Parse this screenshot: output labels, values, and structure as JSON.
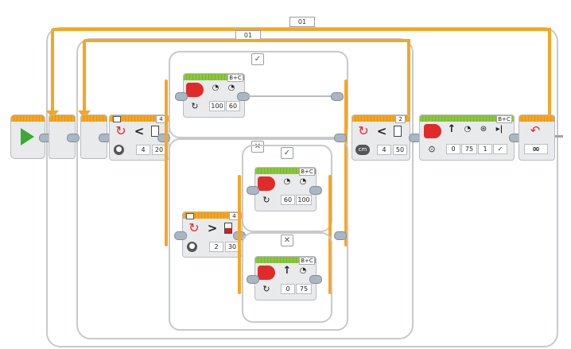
{
  "program": {
    "outer_loop": {
      "name": "01",
      "mode": "infinity"
    },
    "inner_loop": {
      "name": "01",
      "mode": "color sensor compare"
    },
    "start_icon": "play-icon"
  },
  "loop_exit_sensor": {
    "port": "2",
    "operator": "<",
    "value_a": "4",
    "value_b": "50",
    "mode_icon": "cm"
  },
  "switch_main": {
    "sensor_port": "4",
    "operator": "<",
    "value_a": "4",
    "value_b": "20",
    "true_tab": "✓",
    "false_tab": "✕",
    "true_case": {
      "motor_ports": "B+C",
      "power_left": "100",
      "power_right": "60"
    },
    "false_case": {
      "sensor_port": "4",
      "operator": ">",
      "value_a": "2",
      "value_b": "30",
      "true_tab": "✓",
      "false_tab": "✕",
      "true_case": {
        "motor_ports": "B+C",
        "power_left": "60",
        "power_right": "100"
      },
      "false_case": {
        "motor_ports": "B+C",
        "steering": "0",
        "power": "75"
      }
    }
  },
  "move_block": {
    "motor_ports": "B+C",
    "steering": "0",
    "power": "75",
    "rotations": "1",
    "brake": "✓"
  },
  "end_loop": {
    "mode": "∞"
  },
  "colors": {
    "wire": "#f5a623",
    "motor_header": "#8cc63f",
    "sensor_header": "#f7a51c",
    "motor_icon": "#e02b2b"
  }
}
